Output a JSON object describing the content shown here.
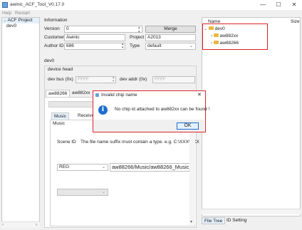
{
  "window": {
    "title": "awinic_ACF_Tool_V0.17.0",
    "minimize_glyph": "—",
    "maximize_glyph": "☐",
    "close_glyph": "✕"
  },
  "menu": {
    "help": "Help",
    "restart": "Restart"
  },
  "left_tree": {
    "root": "ACF Project",
    "child": "dev0",
    "expand_glyph": "⌄"
  },
  "information": {
    "section_title": "Information",
    "version_label": "Version",
    "version_value": "0",
    "merge_label": "Merge",
    "customer_label": "Customer",
    "customer_value": "Awinic",
    "project_label": "Project",
    "project_value": "A2013",
    "author_label": "Author ID",
    "author_value": "686",
    "type_label": "Type",
    "type_value": "default"
  },
  "dev": {
    "title": "dev0",
    "device_head": "device head",
    "dev_bus_label": "dev bus (0x)",
    "dev_bus_value": "FFFF",
    "dev_addr_label": "dev addr (0x)",
    "dev_addr_value": "FFFF"
  },
  "chip_tabs": [
    "aw88266",
    "aw882xx"
  ],
  "sub_tabs": [
    "Music",
    "Receiver"
  ],
  "music": {
    "group_title": "Music",
    "scene_label": "Scene ID",
    "scene_hint": "The file name suffix must contain a type. e.g. C:\\XXX\\XXX",
    "reg_select": "REG",
    "reg_path": "aw88266/Music/aw88266_Music_"
  },
  "right_tree": {
    "col_name": "Name",
    "col_size": "Size",
    "root": "dev0",
    "items": [
      "aw882xx",
      "aw88266"
    ]
  },
  "right_tabs": [
    "File Tree",
    "ID Setting"
  ],
  "dialog": {
    "title": "Invalid chip name",
    "message": "No chip id attached to aw882xx can be found !",
    "ok": "OK",
    "info_glyph": "i",
    "close_glyph": "✕"
  },
  "colors": {
    "accent": "#1e6ed0",
    "highlight_box": "#e02020",
    "folder": "#e8b840"
  }
}
